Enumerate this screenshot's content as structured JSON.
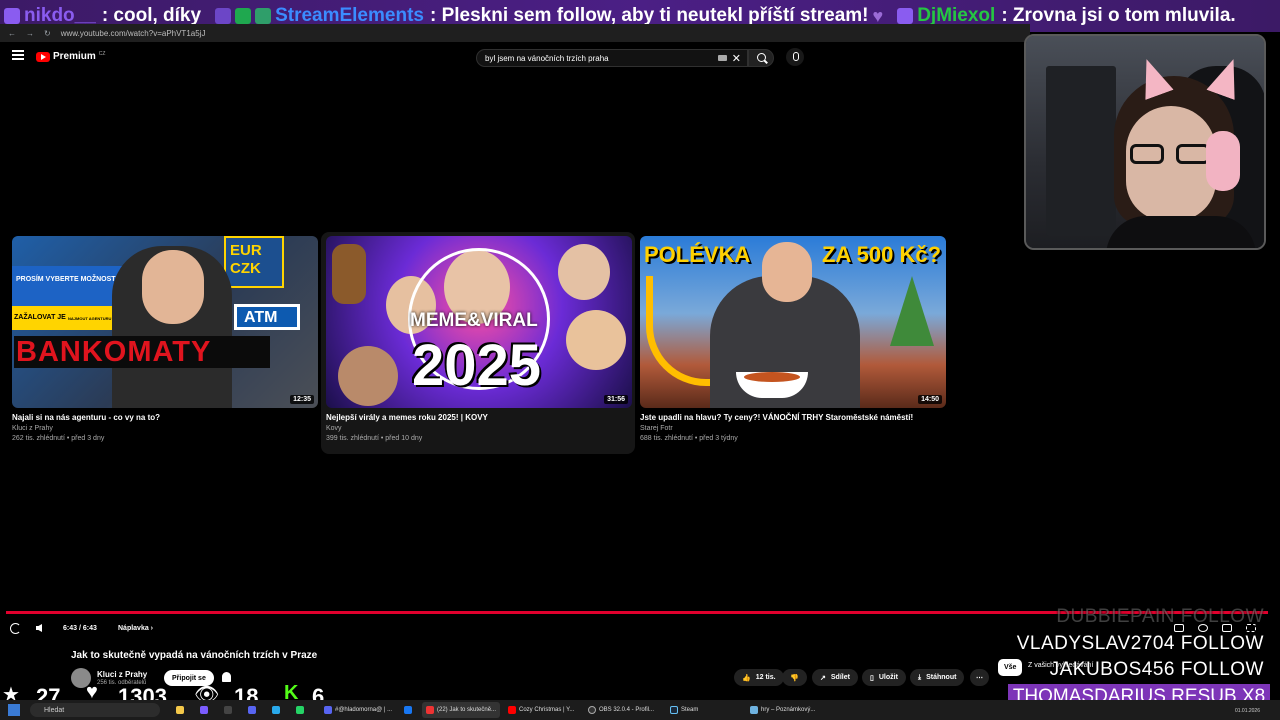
{
  "ticker": {
    "messages": [
      {
        "user": "nikdo__",
        "text": ": cool, díky",
        "color": "#8a5cf0"
      },
      {
        "user": "StreamElements",
        "text": ": Pleskni sem follow, aby ti neutekl příští stream!",
        "color": "#3b8cff"
      },
      {
        "user": "DjMiexol",
        "text": ": Zrovna jsi o tom mluvila.",
        "color": "#25c742"
      }
    ]
  },
  "browser": {
    "url": "www.youtube.com/watch?v=aPhVT1a5jJ"
  },
  "header": {
    "logo_text": "Premium",
    "logo_region": "CZ",
    "search_value": "byl jsem na vánočních trzích praha"
  },
  "videos": [
    {
      "title": "Najali si na nás agenturu - co vy na to?",
      "channel": "Kluci z Prahy",
      "meta": "262 tis. zhlédnutí • před 3 dny",
      "duration": "12:35",
      "thumb_text": [
        "PROSÍM VYBERTE MOŽNOST",
        "ZAŽALOVAT JE",
        "NAJMOUT AGENTURU",
        "EUR",
        "CZK",
        "ATM",
        "BANKOMATY"
      ]
    },
    {
      "title": "Nejlepší virály a memes roku 2025! | KOVY",
      "channel": "Kovy",
      "meta": "399 tis. zhlédnutí • před 10 dny",
      "duration": "31:56",
      "thumb_text": [
        "MEME&VIRAL",
        "2025"
      ]
    },
    {
      "title": "Jste upadli na hlavu? Ty ceny?! VÁNOČNÍ TRHY Staroměstské náměstí!",
      "channel": "Starej Fotr",
      "meta": "688 tis. zhlédnutí • před 3 týdny",
      "duration": "14:50",
      "thumb_text": [
        "POLÉVKA",
        "ZA 500 Kč?"
      ]
    }
  ],
  "player": {
    "time": "6:43 / 6:43",
    "chapter": "Náplavka ›",
    "progress": 1.0
  },
  "video_info": {
    "title": "Jak to skutečně vypadá na vánočních trzích v Praze",
    "channel": "Kluci z Prahy",
    "subs": "256 tis. odběratelů",
    "join_label": "Připojit se",
    "likes": "12 tis.",
    "share_label": "Sdílet",
    "save_label": "Uložit",
    "download_label": "Stáhnout",
    "chip_all": "Vše",
    "chip_sub": "Z vašich vyhledávání"
  },
  "stats": {
    "subs": "27",
    "likes": "1303",
    "viewers": "18",
    "kick": "6"
  },
  "alerts": {
    "follow_1": "DUBBIEPAIN  FOLLOW",
    "follow_2": "VLADYSLAV2704  FOLLOW",
    "follow_3": "JAKUBOS456  FOLLOW",
    "resub": "THOMASDARIUS  RESUB X8"
  },
  "taskbar": {
    "search": "Hledat",
    "items": [
      "#@hladomorna@ | ...",
      "(22) Jak to skutečně...",
      "Cozy Christmas | Y...",
      "OBS 32.0.4 - Profil...",
      "Steam",
      "hry – Poznámkový..."
    ],
    "date": "01.01.2026"
  },
  "colors": {
    "accent_red": "#ff0000",
    "progress": "#e1002d",
    "alert_purple": "#7d35b8"
  }
}
